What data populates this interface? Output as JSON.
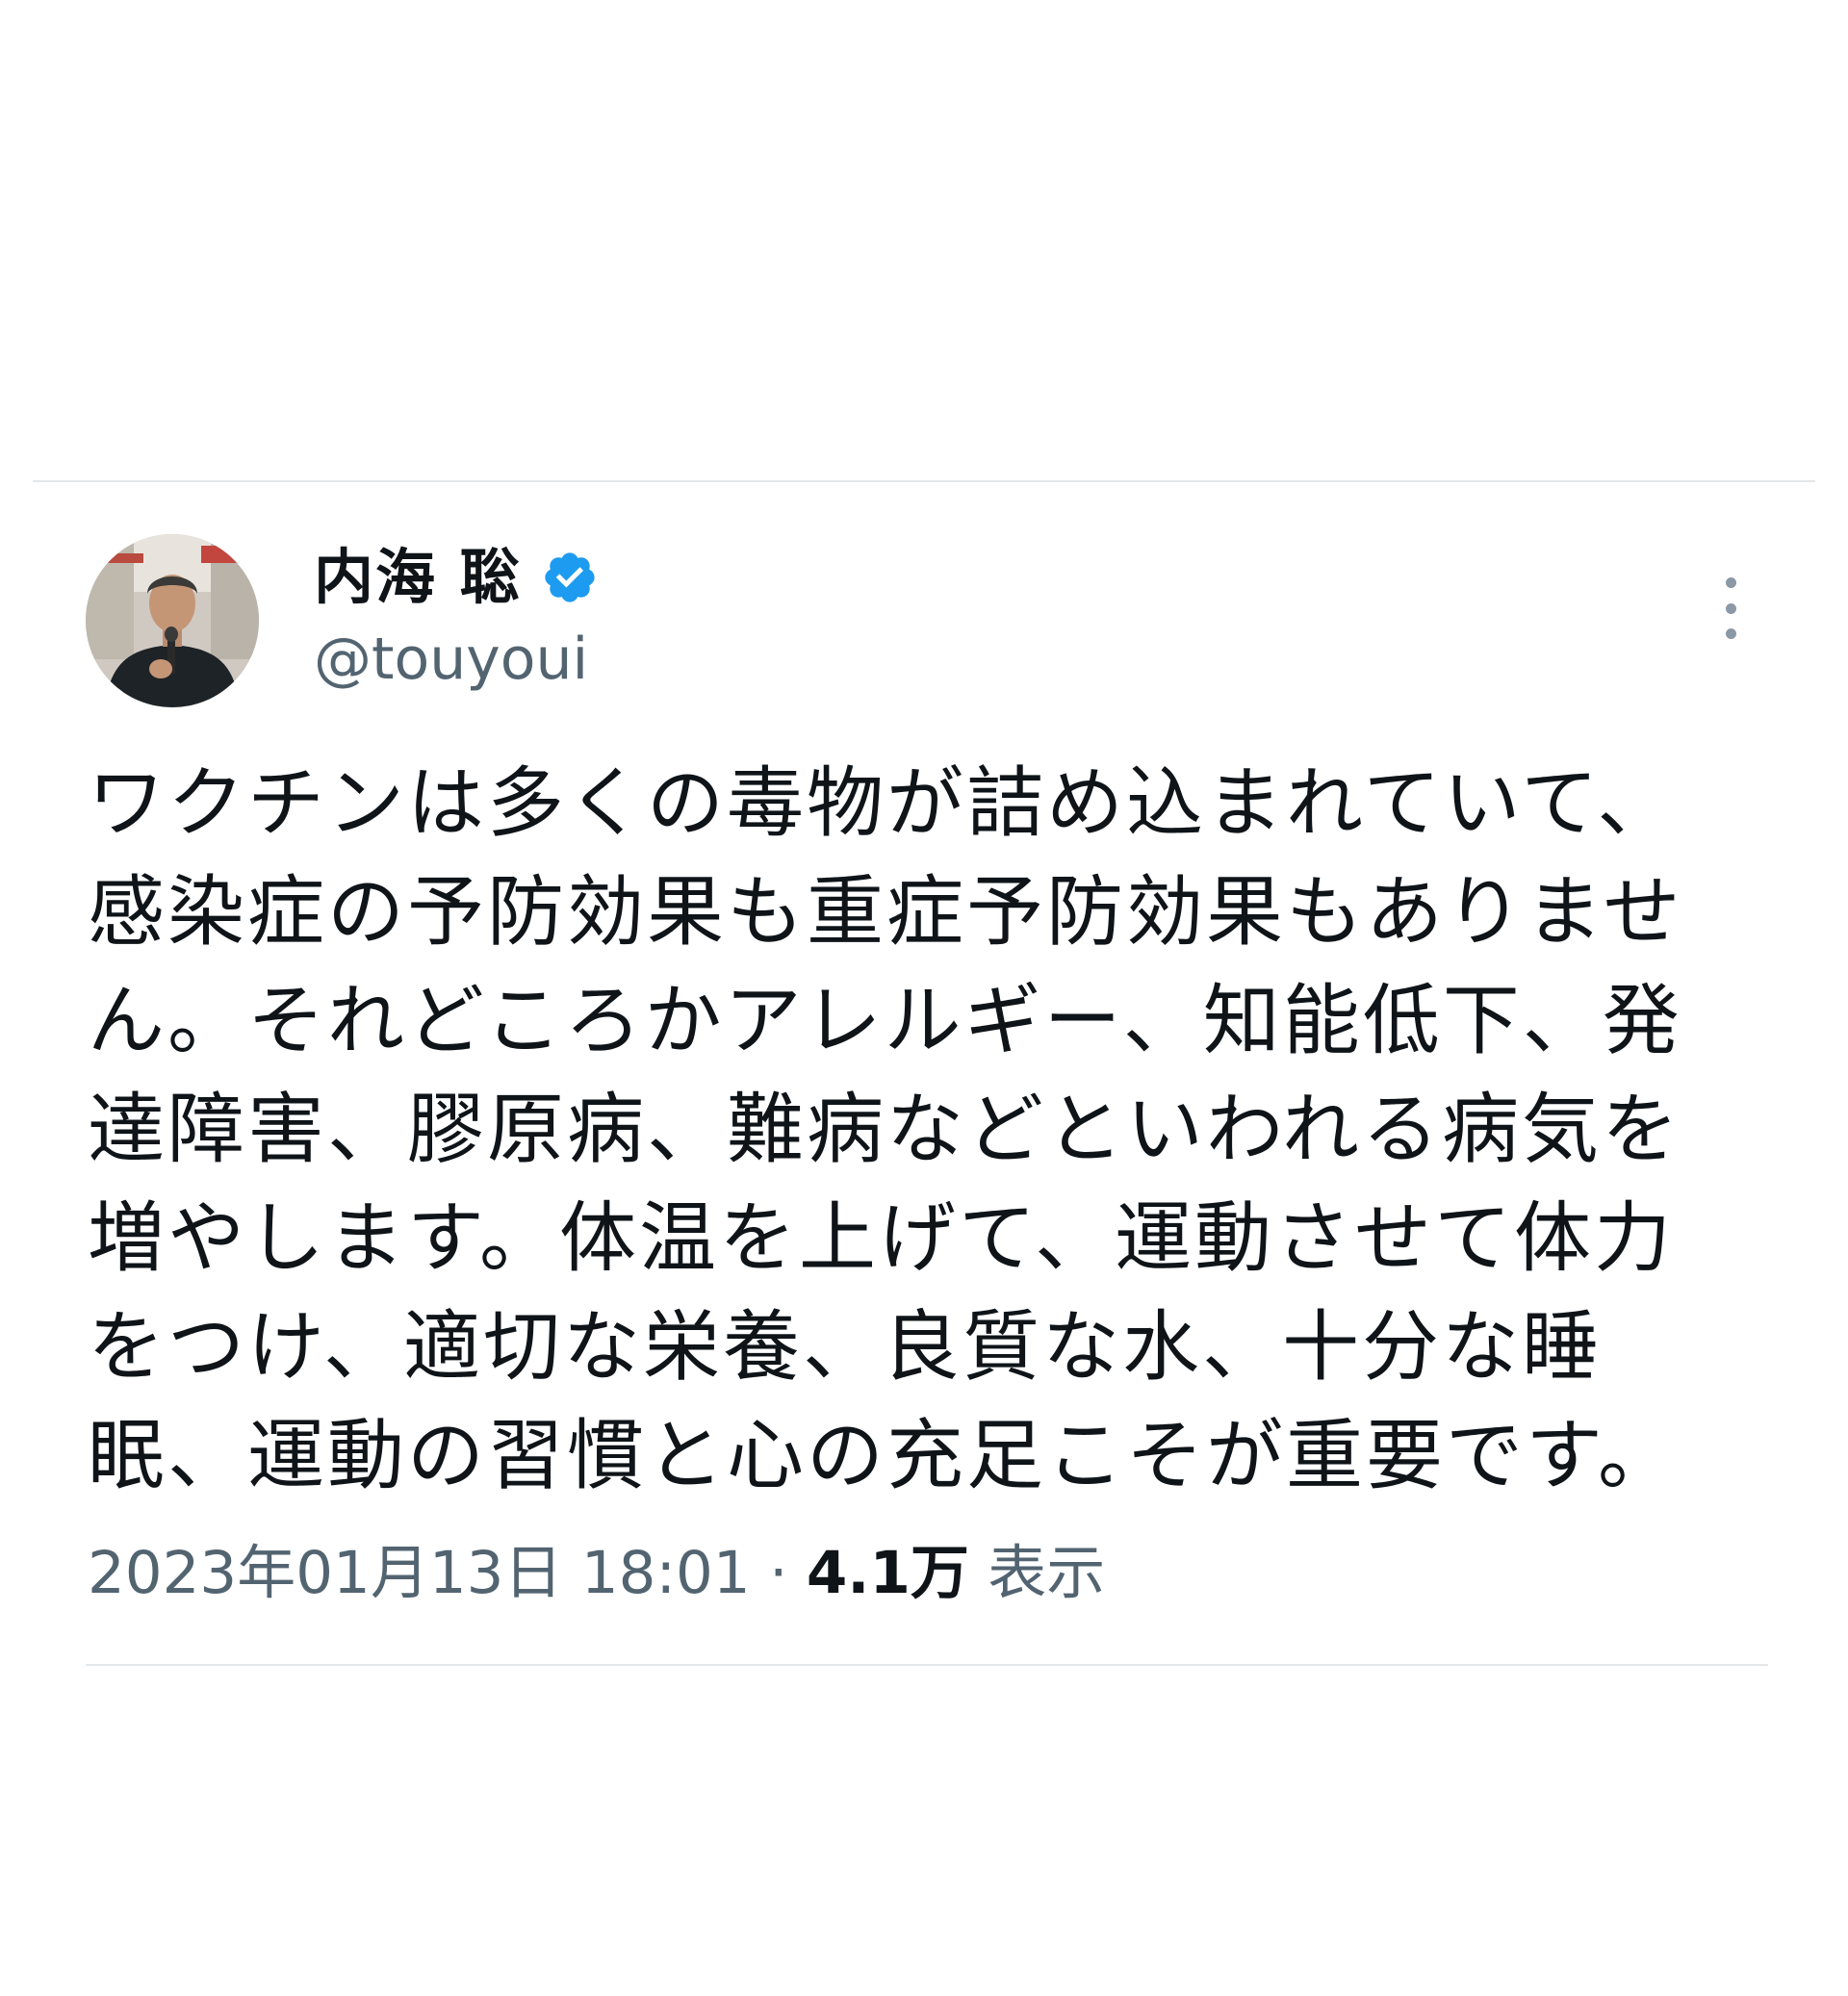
{
  "tweet": {
    "author": {
      "display_name": "内海 聡",
      "handle": "@touyoui",
      "verified": true,
      "avatar_icon": "person-speaking-photo"
    },
    "more_icon": "more-vertical-icon",
    "text": "ワクチンは多くの毒物が詰め込まれていて、\n感染症の予防効果も重症予防効果もありませ\nん。それどころかアレルギー、知能低下、発\n達障害、膠原病、難病などといわれる病気を\n増やします。体温を上げて、運動させて体力\nをつけ、適切な栄養、良質な水、十分な睡\n眠、運動の習慣と心の充足こそが重要です。",
    "timestamp": "2023年01月13日 18:01",
    "separator": "·",
    "views_count": "4.1万",
    "views_label": "表示"
  },
  "colors": {
    "verified_badge": "#1d9bf0",
    "secondary_text": "#536471",
    "primary_text": "#0f1419",
    "divider": "#e3e7ea"
  }
}
